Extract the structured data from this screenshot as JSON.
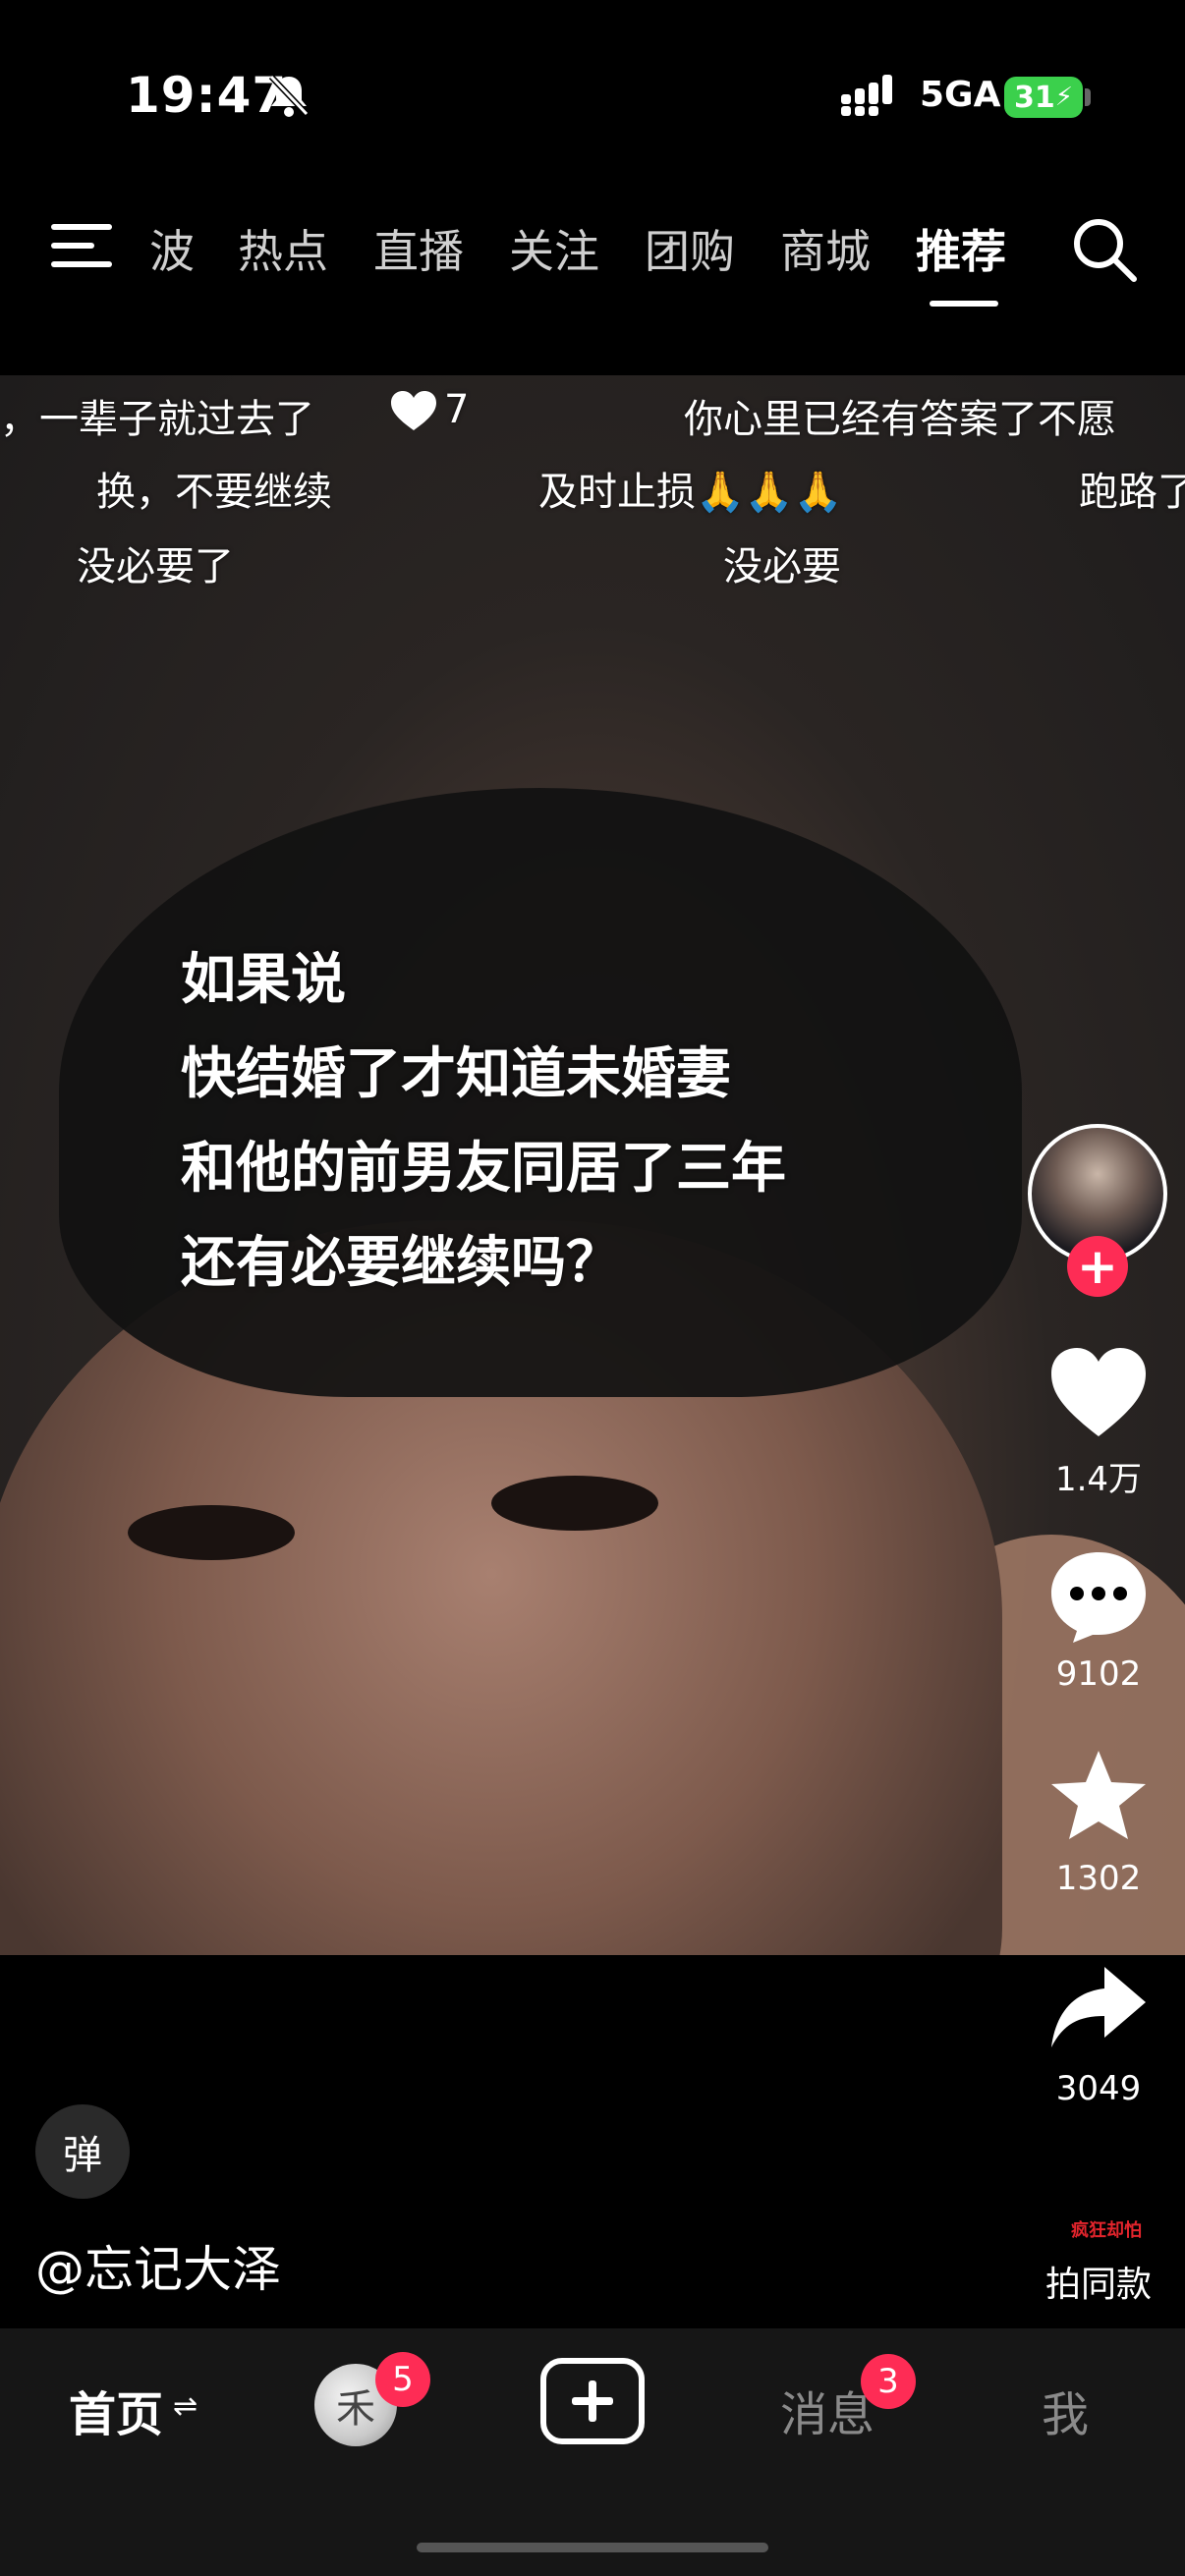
{
  "status_bar": {
    "time": "19:47",
    "network": "5GA",
    "battery": "31"
  },
  "top_nav": {
    "tabs": [
      {
        "label": "波",
        "active": false
      },
      {
        "label": "热点",
        "active": false
      },
      {
        "label": "直播",
        "active": false
      },
      {
        "label": "关注",
        "active": false
      },
      {
        "label": "团购",
        "active": false
      },
      {
        "label": "商城",
        "active": false
      },
      {
        "label": "推荐",
        "active": true
      }
    ]
  },
  "video": {
    "danmu": [
      {
        "text": "，一辈子就过去了"
      },
      {
        "text": "7"
      },
      {
        "text": "你心里已经有答案了不愿"
      },
      {
        "text": "换，不要继续"
      },
      {
        "text": "及时止损🙏🙏🙏"
      },
      {
        "text": "跑路了"
      },
      {
        "text": "没必要了"
      },
      {
        "text": "没必要"
      }
    ],
    "caption_lines": [
      "如果说",
      "快结婚了才知道未婚妻",
      "和他的前男友同居了三年",
      "还有必要继续吗？"
    ]
  },
  "actions": {
    "like_count": "1.4万",
    "comment_count": "9102",
    "favorite_count": "1302",
    "share_count": "3049",
    "remix_logo": "疯狂却怕",
    "remix_label": "拍同款"
  },
  "bottom_overlay": {
    "danmu_toggle": "弹",
    "author": "@忘记大泽"
  },
  "bottom_nav": {
    "home": "首页",
    "home_arrows": "⇌",
    "friend_avatar_char": "禾",
    "friend_badge": "5",
    "messages": "消息",
    "messages_badge": "3",
    "me": "我"
  },
  "colors": {
    "accent": "#fe2c55",
    "battery": "#3bd04c"
  }
}
